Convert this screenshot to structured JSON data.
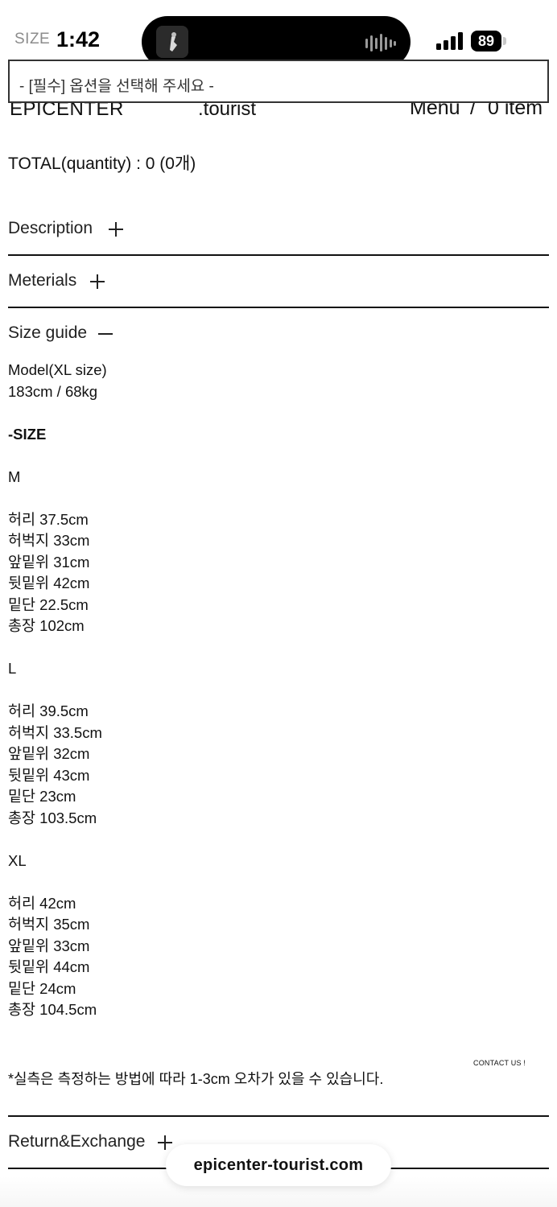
{
  "status_bar": {
    "size_tag": "SIZE",
    "time": "1:42",
    "battery": "89",
    "icons": [
      "signal-icon",
      "battery-icon",
      "audio-wave-icon"
    ]
  },
  "header": {
    "logo_left": "EPICENTER",
    "logo_right": ".tourist",
    "menu": "Menu",
    "separator": "/",
    "cart": "0 item"
  },
  "option_select": {
    "placeholder": "- [필수] 옵션을 선택해 주세요 -"
  },
  "total": "TOTAL(quantity) : 0 (0개)",
  "accordion": {
    "description": "Description",
    "materials": "Meterials",
    "size_guide": "Size guide",
    "return_exchange": "Return&Exchange"
  },
  "size_guide": {
    "model_line1": "Model(XL size)",
    "model_line2": "183cm / 68kg",
    "heading": "-SIZE",
    "sizes": [
      {
        "name": "M",
        "lines": [
          "허리 37.5cm",
          "허벅지 33cm",
          "앞밑위 31cm",
          "뒷밑위 42cm",
          "밑단 22.5cm",
          "총장 102cm"
        ]
      },
      {
        "name": "L",
        "lines": [
          "허리 39.5cm",
          "허벅지 33.5cm",
          "앞밑위 32cm",
          "뒷밑위 43cm",
          "밑단 23cm",
          "총장 103.5cm"
        ]
      },
      {
        "name": "XL",
        "lines": [
          "허리 42cm",
          "허벅지 35cm",
          "앞밑위 33cm",
          "뒷밑위 44cm",
          "밑단 24cm",
          "총장 104.5cm"
        ]
      }
    ],
    "note": "*실측은 측정하는 방법에 따라 1-3cm 오차가 있을 수 있습니다."
  },
  "contact": "CONTACT US !",
  "browser": {
    "url": "epicenter-tourist.com"
  }
}
